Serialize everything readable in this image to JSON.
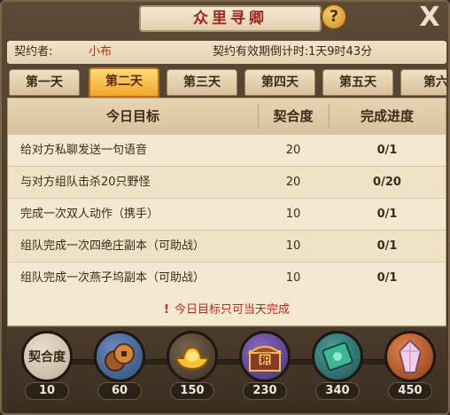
{
  "window": {
    "title": "众里寻卿",
    "help_symbol": "?",
    "close_symbol": "X"
  },
  "contract": {
    "label": "契约者:",
    "name": "小布",
    "countdown_label": "契约有效期倒计时:",
    "countdown_value": "1天9时43分"
  },
  "tabs": [
    {
      "label": "第一天",
      "active": false
    },
    {
      "label": "第二天",
      "active": true
    },
    {
      "label": "第三天",
      "active": false
    },
    {
      "label": "第四天",
      "active": false
    },
    {
      "label": "第五天",
      "active": false
    },
    {
      "label": "第六",
      "active": false
    }
  ],
  "table": {
    "headers": [
      "今日目标",
      "契合度",
      "完成进度"
    ],
    "rows": [
      {
        "goal": "给对方私聊发送一句语音",
        "points": "20",
        "progress": "0/1"
      },
      {
        "goal": "与对方组队击杀20只野怪",
        "points": "20",
        "progress": "0/20"
      },
      {
        "goal": "完成一次双人动作（携手）",
        "points": "10",
        "progress": "0/1"
      },
      {
        "goal": "组队完成一次四绝庄副本（可助战）",
        "points": "10",
        "progress": "0/1"
      },
      {
        "goal": "组队完成一次燕子坞副本（可助战）",
        "points": "10",
        "progress": "0/1"
      }
    ]
  },
  "notice": {
    "bang": "!",
    "text": "今日目标只可当天完成"
  },
  "rewards": [
    {
      "label": "契合度",
      "count": "10",
      "icon": "affinity-icon"
    },
    {
      "count": "60",
      "icon": "coins-icon"
    },
    {
      "count": "150",
      "icon": "gold-ingot-icon"
    },
    {
      "count": "230",
      "icon": "treasure-chest-icon",
      "chest_text": "积"
    },
    {
      "count": "340",
      "icon": "jade-token-icon"
    },
    {
      "count": "450",
      "icon": "crystal-icon"
    }
  ],
  "colors": {
    "accent_red": "#c02a1a",
    "tab_active": "#f1a72a"
  }
}
